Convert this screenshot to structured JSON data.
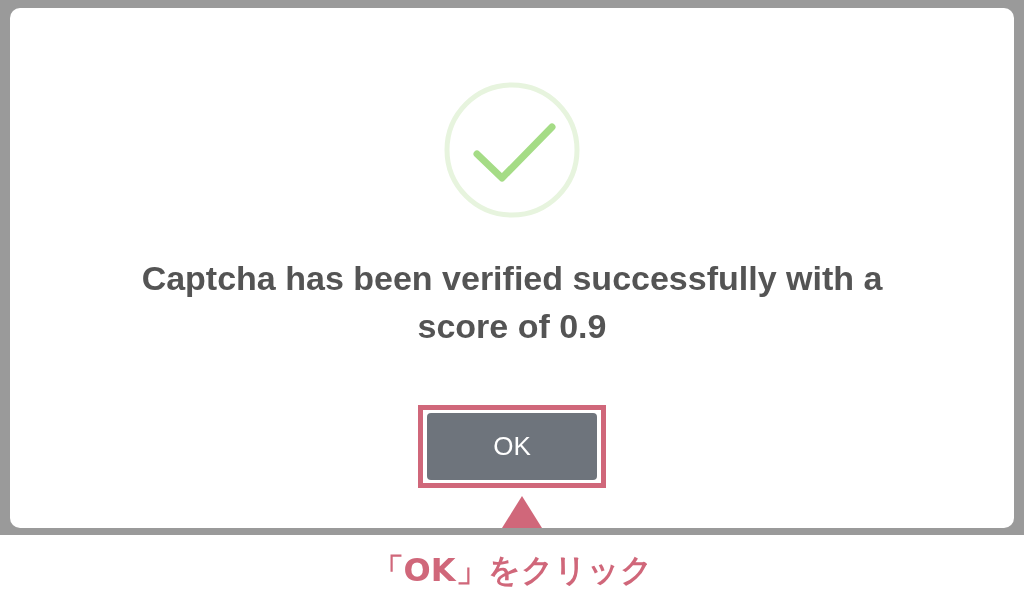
{
  "dialog": {
    "message": "Captcha has been verified successfully with a score of 0.9",
    "button": "OK"
  },
  "annotation": {
    "caption": "「OK」をクリック"
  }
}
